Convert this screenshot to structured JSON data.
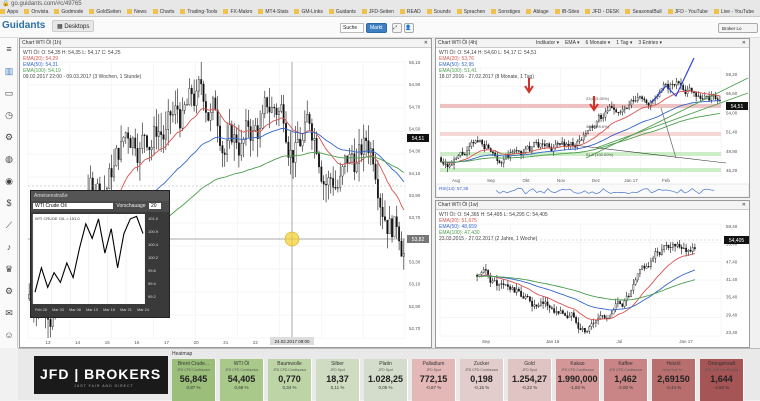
{
  "browser": {
    "url": "go.guidants.com/#c/49765",
    "bookmarks": [
      "Apps",
      "Onvista",
      "Godmode",
      "GoldSeiten",
      "News",
      "Charts",
      "Trading-Tools",
      "FX-Makro",
      "MT4-Stats",
      "GM-Links",
      "Guidants",
      "JFD-Seiten",
      "READ",
      "Sounds",
      "Sprachen",
      "Sonstiges",
      "Ablage",
      "IB-Sites",
      "JFD - DESK",
      "SeasonalBull",
      "JFD - YouTube",
      "Live - YouTube"
    ],
    "right_link": "Broker Lo"
  },
  "app": {
    "logo": "Guidants",
    "tabs": [
      "Desktops"
    ],
    "search_label": "Suche",
    "markt_label": "Markt"
  },
  "sidebar_icons": [
    "menu-icon",
    "chart-icon",
    "monitor-icon",
    "clock-icon",
    "gear-icon",
    "globe-icon",
    "eye-icon",
    "dollar-icon",
    "chart-line-icon",
    "bell-icon",
    "trophy-icon",
    "settings-icon",
    "mail-icon",
    "users-icon",
    "chat-icon",
    "plus-icon"
  ],
  "main_chart": {
    "title": "Chart WTI Öl (1h)",
    "info1": "WTI Öl: O: 54,35  H: 54,35  L: 54,17  C: 54,25",
    "info2": "EMA(20): 54,29",
    "info3": "EMA(50): 54,31",
    "info4": "EMA(100): 54,19",
    "info5": "09.02.2017 22:00 - 09.03.2017 (3 Wochen, 1 Stunde)",
    "price_tag": "54,51",
    "cursor_price": "53,82",
    "cursor_date": "24.02.2017 09:00",
    "y_ticks": [
      "55,10",
      "54,90",
      "54,70",
      "54,50",
      "54,30",
      "54,10",
      "53,90",
      "53,70",
      "53,50",
      "53,30",
      "53,10",
      "52,90",
      "52,70"
    ],
    "x_ticks": [
      "13",
      "14",
      "15",
      "16",
      "17",
      "20",
      "21",
      "22",
      "23"
    ]
  },
  "mini_chart": {
    "window_title": "Ameisenstraße",
    "instrument": "WTI Crude Oil",
    "label": "Vorschauage",
    "field": "20",
    "inner_label": "WTI CRUDE OIL = 151.0",
    "y_ticks": [
      "101.0",
      "100.9",
      "100.4",
      "100.2",
      "99.8",
      "99.4",
      "99.2"
    ],
    "x_ticks": [
      "Feb 28",
      "Mar 03",
      "Mar 08",
      "Mar 13",
      "Mar 16",
      "Mar 21",
      "Mar 24"
    ],
    "series": [
      99.4,
      99.9,
      99.5,
      99.8,
      99.6,
      100.0,
      99.7,
      100.3,
      100.8,
      100.5,
      100.9,
      100.2,
      100.7,
      99.9,
      100.6,
      100.9,
      100.95,
      100.6
    ]
  },
  "top_right_chart": {
    "title": "Chart WTI Öl (4h)",
    "toolbar": [
      "Indikator",
      "EMA",
      "6 Monate",
      "1 Tag",
      "3 Entries"
    ],
    "info1": "WTI Öl: O: 54,14  H: 54,60  L: 54,17  C: 54,51",
    "info2": "EMA(20): 53,76",
    "info3": "EMA(50): 52,95",
    "info4": "EMA(100): 51,41",
    "info5": "18.07.2016 - 27.02.2017 (8 Monate, 1 Tag)",
    "price_tag": "54,51",
    "rsi_label": "RSI(14): 57,35",
    "fib_labels": [
      "23,6 (5.00%)",
      "38,2 (78.6%)",
      "61,8 (100.00%)"
    ],
    "y_ticks": [
      "59,20",
      "56,60",
      "54,00",
      "51,40",
      "48,80",
      "46,20"
    ],
    "x_ticks": [
      "Aug",
      "Sep",
      "Okt",
      "Nov",
      "Dez",
      "Jan 17",
      "Feb"
    ]
  },
  "bottom_right_chart": {
    "title": "Chart WTI Öl (1w)",
    "info1": "WTI Öl: O: 54,365  H: 54,495  L: 54,295  C: 54,405",
    "info2": "EMA(20): 51,675",
    "info3": "EMA(50): 48,659",
    "info4": "EMA(100): 47,430",
    "info5": "23.03.2015 - 27.02.2017 (2 Jahre, 1 Woche)",
    "price_tag": "54,405",
    "y_ticks": [
      "59,40",
      "53,40",
      "47,40",
      "41,40",
      "35,40",
      "29,40",
      "23,40"
    ],
    "x_ticks": [
      "Sep",
      "Jan 16",
      "Jul",
      "Jan 17"
    ]
  },
  "heatmap": {
    "title": "Heatmap",
    "jfd_main": "JFD | BROKERS",
    "jfd_sub": "JUST FAIR AND DIRECT",
    "tiles": [
      {
        "name": "Brent Crude...",
        "sub": "JFD CFD Continuous",
        "value": "56,845",
        "change": "0,87 %",
        "color": "#9bbf7b"
      },
      {
        "name": "WTI Öl",
        "sub": "JFD CFD Continuous",
        "value": "54,405",
        "change": "0,68 %",
        "color": "#a9c98b"
      },
      {
        "name": "Baumwolle",
        "sub": "JFD CFD Continuous",
        "value": "0,770",
        "change": "0,34 %",
        "color": "#bcd4a6"
      },
      {
        "name": "Silber",
        "sub": "JFD Spot",
        "value": "18,37",
        "change": "0,11 %",
        "color": "#cfdcc2"
      },
      {
        "name": "Platin",
        "sub": "JFD Spot",
        "value": "1.028,25",
        "change": "0,05 %",
        "color": "#d4ddcb"
      },
      {
        "name": "Palladium",
        "sub": "JFD Spot",
        "value": "772,15",
        "change": "-0,87 %",
        "color": "#e5b8b8"
      },
      {
        "name": "Zucker",
        "sub": "JFD CFD Continuous",
        "value": "0,198",
        "change": "-0,15 %",
        "color": "#e3cccc"
      },
      {
        "name": "Gold",
        "sub": "JFD Spot",
        "value": "1.254,27",
        "change": "-0,22 %",
        "color": "#e0c3c3"
      },
      {
        "name": "Kakao",
        "sub": "JFD CFD Continuous",
        "value": "1.990,000",
        "change": "-1,83 %",
        "color": "#d49797"
      },
      {
        "name": "Kaffee",
        "sub": "JFD CFD Continuous",
        "value": "1,462",
        "change": "-2,00 %",
        "color": "#c98585"
      },
      {
        "name": "Heizöl",
        "sub": "Heiz/ Hub N...",
        "value": "2,69150",
        "change": "-3,44 %",
        "color": "#b96e6e"
      },
      {
        "name": "Orangensaft",
        "sub": "JFD CFD Continuous",
        "value": "1,644",
        "change": "-4,50 %",
        "color": "#a55555"
      }
    ]
  },
  "colors": {
    "accent": "#3e7fc1",
    "price_red": "#d2312b",
    "ema20": "#d9534f",
    "ema50": "#3366cc",
    "ema100": "#4b9e4b"
  }
}
